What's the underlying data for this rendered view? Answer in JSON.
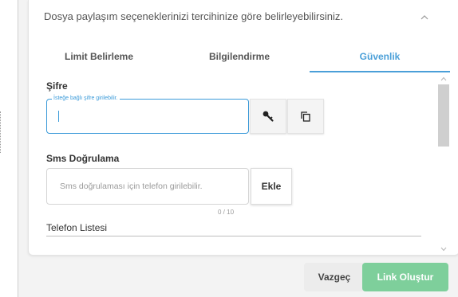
{
  "card": {
    "description": "Dosya paylaşım seçeneklerinizi tercihinize göre belirleyebilirsiniz.",
    "collapse_icon": "chevron-up-icon"
  },
  "tabs": [
    {
      "label": "Limit Belirleme",
      "active": false
    },
    {
      "label": "Bilgilendirme",
      "active": false
    },
    {
      "label": "Güvenlik",
      "active": true
    }
  ],
  "password": {
    "label": "Şifre",
    "floating_label": "İsteğe bağlı şifre girilebilir.",
    "value": "",
    "generate_icon": "key-icon",
    "copy_icon": "copy-icon"
  },
  "sms": {
    "label": "Sms Doğrulama",
    "placeholder": "Sms doğrulaması için telefon girilebilir.",
    "add_label": "Ekle",
    "counter": "0 / 10"
  },
  "phone_list": {
    "label": "Telefon Listesi"
  },
  "footer": {
    "cancel_label": "Vazgeç",
    "create_label": "Link Oluştur"
  },
  "colors": {
    "accent": "#4a9fd8",
    "create_button": "#7ecf9b",
    "cancel_button": "#ececec"
  }
}
